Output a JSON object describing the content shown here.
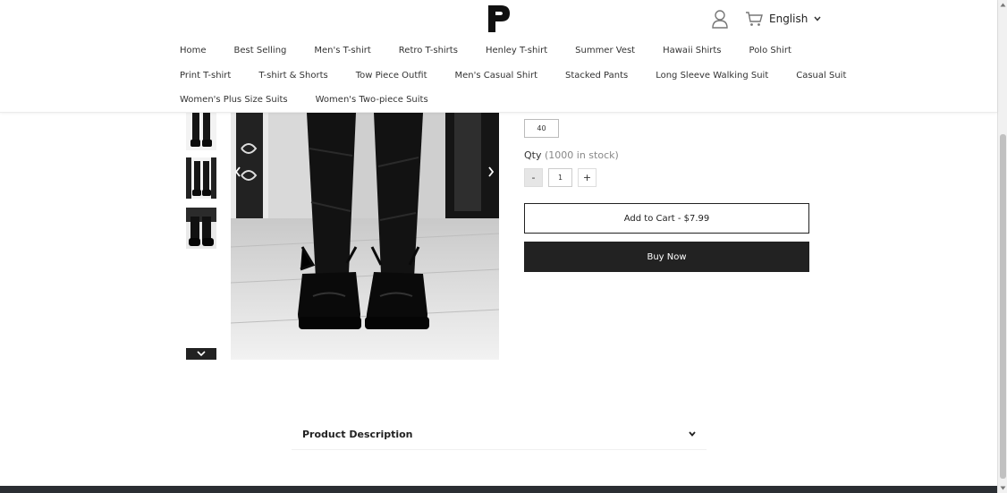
{
  "header": {
    "logo_icon": "p-logo-icon",
    "language": "English",
    "icons": [
      "user-icon",
      "cart-icon",
      "chevron-down-icon"
    ]
  },
  "nav": {
    "row1": [
      "Home",
      "Best Selling",
      "Men's T-shirt",
      "Retro T-shirts",
      "Henley T-shirt",
      "Summer Vest",
      "Hawaii Shirts",
      "Polo Shirt"
    ],
    "row2": [
      "Print T-shirt",
      "T-shirt & Shorts",
      "Tow Piece Outfit",
      "Men's Casual Shirt",
      "Stacked Pants",
      "Long Sleeve Walking Suit",
      "Casual Suit"
    ],
    "row3": [
      "Women's Plus Size Suits",
      "Women's Two-piece Suits"
    ]
  },
  "product": {
    "size_option": "40",
    "qty_label": "Qty",
    "stock_text": "(1000 in stock)",
    "qty_minus": "-",
    "qty_value": "1",
    "qty_plus": "+",
    "add_to_cart": "Add to Cart - $7.99",
    "buy_now": "Buy Now"
  },
  "description": {
    "title": "Product Description"
  },
  "colors": {
    "accent_dark": "#222222",
    "footer": "#2b2e33",
    "border": "#bbbbbb"
  }
}
